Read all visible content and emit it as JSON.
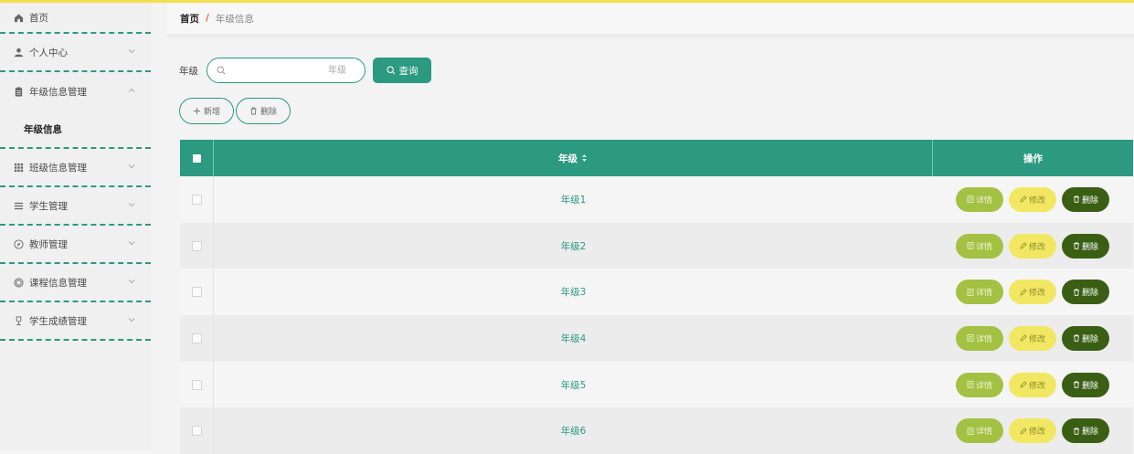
{
  "sidebar": {
    "items": [
      {
        "label": "首页",
        "icon": "home-icon"
      },
      {
        "label": "个人中心",
        "icon": "user-icon"
      },
      {
        "label": "年级信息管理",
        "icon": "clipboard-icon",
        "sub": [
          "年级信息"
        ]
      },
      {
        "label": "班级信息管理",
        "icon": "grid-icon"
      },
      {
        "label": "学生管理",
        "icon": "menu-icon"
      },
      {
        "label": "教师管理",
        "icon": "compass-icon"
      },
      {
        "label": "课程信息管理",
        "icon": "globe-icon"
      },
      {
        "label": "学生成绩管理",
        "icon": "trophy-icon"
      }
    ]
  },
  "breadcrumb": {
    "home": "首页",
    "separator": "/",
    "current": "年级信息"
  },
  "search": {
    "label": "年级",
    "placeholder": "年级",
    "value": "",
    "button": "查询"
  },
  "actions": {
    "add": "新增",
    "delete": "删除"
  },
  "table": {
    "headers": [
      "年级",
      "操作"
    ],
    "rows": [
      "年级1",
      "年级2",
      "年级3",
      "年级4",
      "年级5",
      "年级6"
    ],
    "row_actions": {
      "detail": "详情",
      "edit": "修改",
      "delete": "删除"
    }
  },
  "colors": {
    "accent": "#2b9a80",
    "topbar": "#f4e04d",
    "detail": "#a3c142",
    "edit": "#f2e762",
    "delete": "#3a5f14"
  }
}
